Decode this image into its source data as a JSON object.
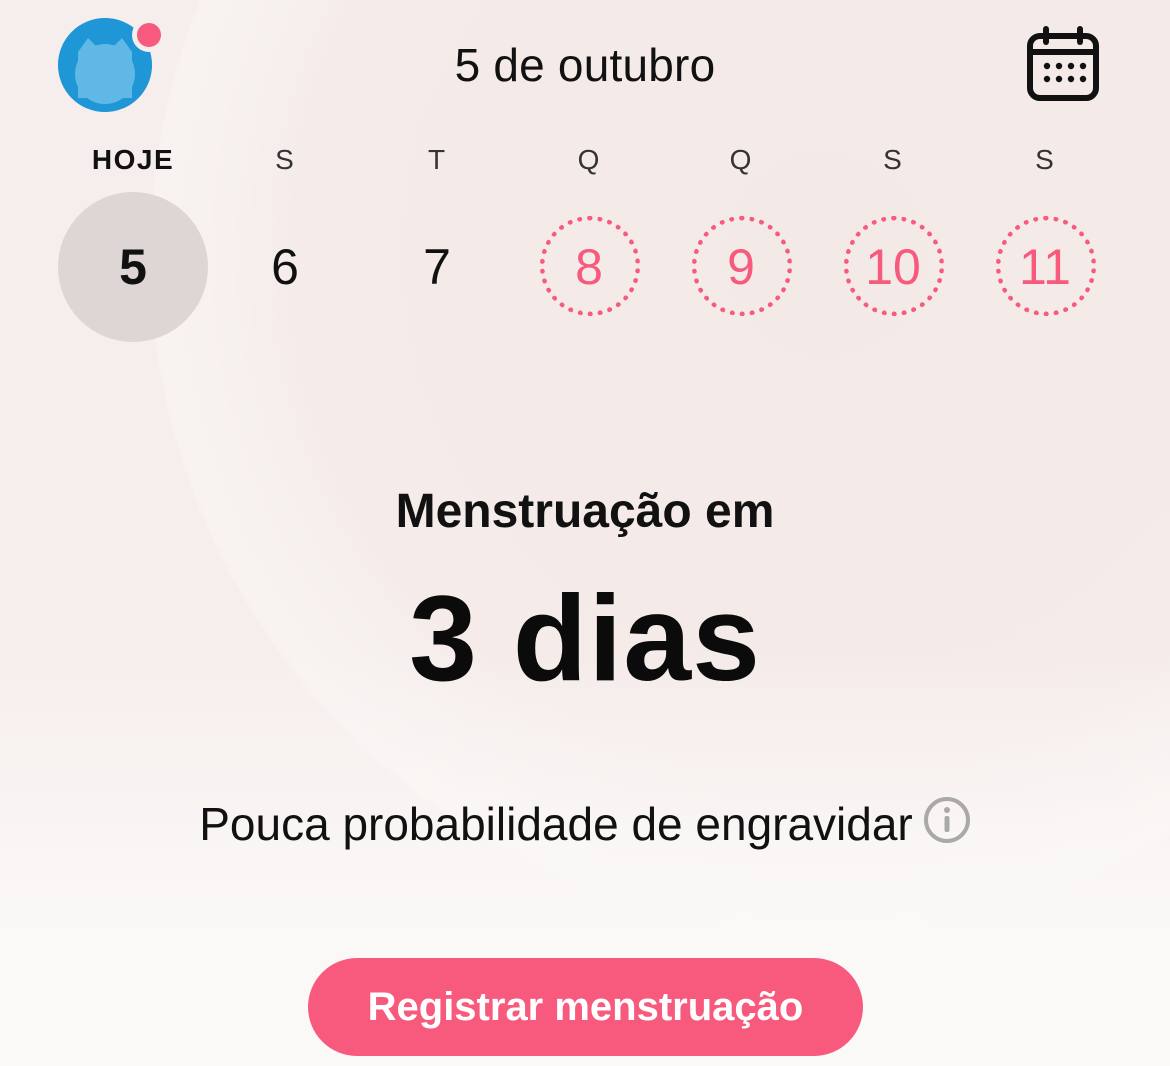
{
  "header": {
    "date_title": "5 de outubro",
    "avatar_icon": "cat-avatar-icon",
    "calendar_icon": "calendar-icon"
  },
  "week": {
    "days": [
      {
        "weekday": "HOJE",
        "date": "5",
        "state": "today"
      },
      {
        "weekday": "S",
        "date": "6",
        "state": "normal"
      },
      {
        "weekday": "T",
        "date": "7",
        "state": "normal"
      },
      {
        "weekday": "Q",
        "date": "8",
        "state": "predicted"
      },
      {
        "weekday": "Q",
        "date": "9",
        "state": "predicted"
      },
      {
        "weekday": "S",
        "date": "10",
        "state": "predicted"
      },
      {
        "weekday": "S",
        "date": "11",
        "state": "predicted"
      }
    ]
  },
  "main": {
    "subtitle": "Menstruação em",
    "countdown": "3 dias",
    "probability_text": "Pouca probabilidade de engravidar",
    "info_icon": "info-icon",
    "cta_label": "Registrar menstruação"
  },
  "colors": {
    "accent": "#f75a7c",
    "avatar": "#1f97d6",
    "today_circle": "#ddd6d4",
    "background": "#f6eeec"
  }
}
